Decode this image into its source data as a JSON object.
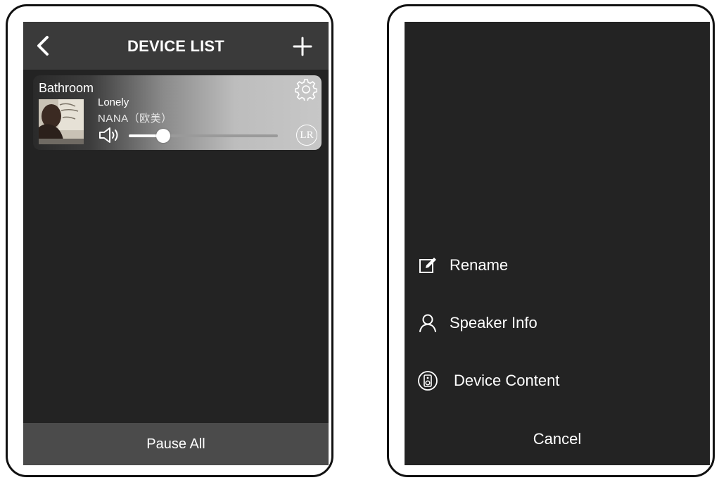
{
  "device_list_screen": {
    "title": "DEVICE LIST",
    "back_icon": "chevron-left-icon",
    "add_icon": "plus-icon",
    "device": {
      "room": "Bathroom",
      "track_title": "Lonely",
      "track_artist": "NANA（欧美）",
      "volume_level": 0.23,
      "settings_icon": "gear-icon",
      "channel_badge": "LR",
      "volume_icon": "speaker-volume-icon"
    },
    "pause_all_label": "Pause All"
  },
  "action_sheet_screen": {
    "items": [
      {
        "label": "Rename",
        "icon": "edit-icon"
      },
      {
        "label": "Speaker Info",
        "icon": "person-icon"
      },
      {
        "label": "Device Content",
        "icon": "speaker-icon"
      }
    ],
    "cancel_label": "Cancel"
  },
  "colors": {
    "screen_bg": "#232323",
    "topbar_bg": "#3a3a3a",
    "bottom_bar_bg": "#4b4b4b",
    "text": "#ffffff"
  }
}
